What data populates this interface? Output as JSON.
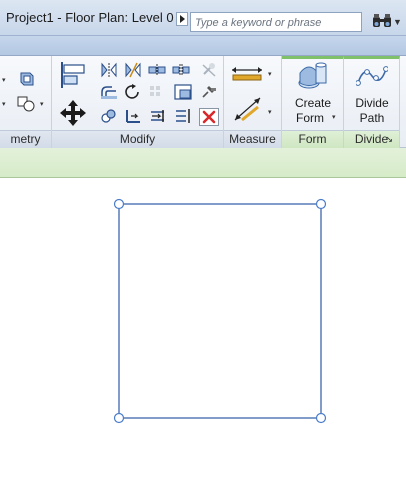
{
  "window": {
    "title": "Project1 - Floor Plan: Level 0"
  },
  "search": {
    "placeholder": "Type a keyword or phrase"
  },
  "ribbon": {
    "panels": {
      "geometry": {
        "label": "metry"
      },
      "modify": {
        "label": "Modify"
      },
      "measure": {
        "label": "Measure"
      },
      "form": {
        "label": "Form",
        "create_form_line1": "Create",
        "create_form_line2": "Form"
      },
      "divide": {
        "label": "Divide",
        "divide_path_line1": "Divide",
        "divide_path_line2": "Path"
      }
    }
  },
  "colors": {
    "sketch_line": "#2e5aa6",
    "grip": "#4a7cc9",
    "option_bar": "#d6ebc8",
    "delete_red": "#d9282b"
  }
}
